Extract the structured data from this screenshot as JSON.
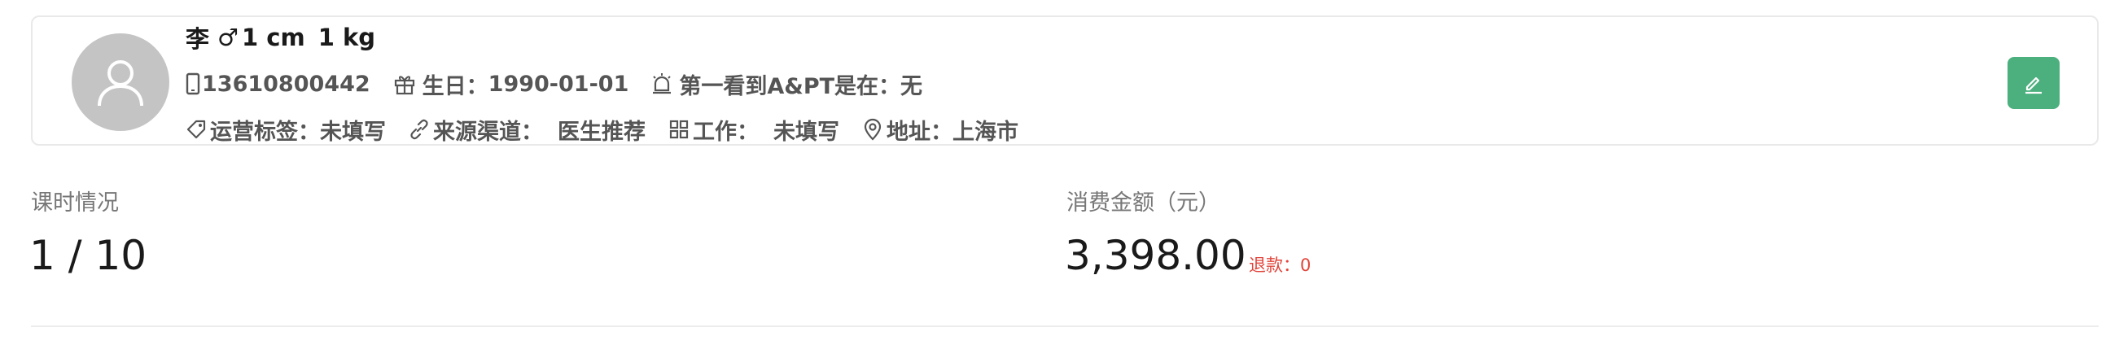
{
  "profile": {
    "name": "李",
    "gender_symbol": "♂",
    "height": "1 cm",
    "weight": "1 kg",
    "phone": "13610800442",
    "birthday_label": "生日：",
    "birthday_value": "1990-01-01",
    "first_seen_label": "第一看到A&PT是在：",
    "first_seen_value": "无",
    "tags_label": "运营标签：",
    "tags_value": "未填写",
    "source_label": "来源渠道：",
    "source_value": "医生推荐",
    "work_label": "工作：",
    "work_value": "未填写",
    "address_label": "地址：",
    "address_value": "上海市"
  },
  "stats": {
    "lessons_label": "课时情况",
    "lessons_value": "1 / 10",
    "spend_label": "消费金额（元）",
    "spend_value": "3,398.00",
    "refund_text": "退款：0"
  },
  "colors": {
    "accent": "#4caf7e",
    "refund": "#e0443a",
    "avatar": "#c4c4c4"
  },
  "icons": [
    "user-icon",
    "phone-icon",
    "gift-icon",
    "alarm-icon",
    "tag-icon",
    "link-icon",
    "grid-icon",
    "location-icon",
    "edit-icon"
  ]
}
